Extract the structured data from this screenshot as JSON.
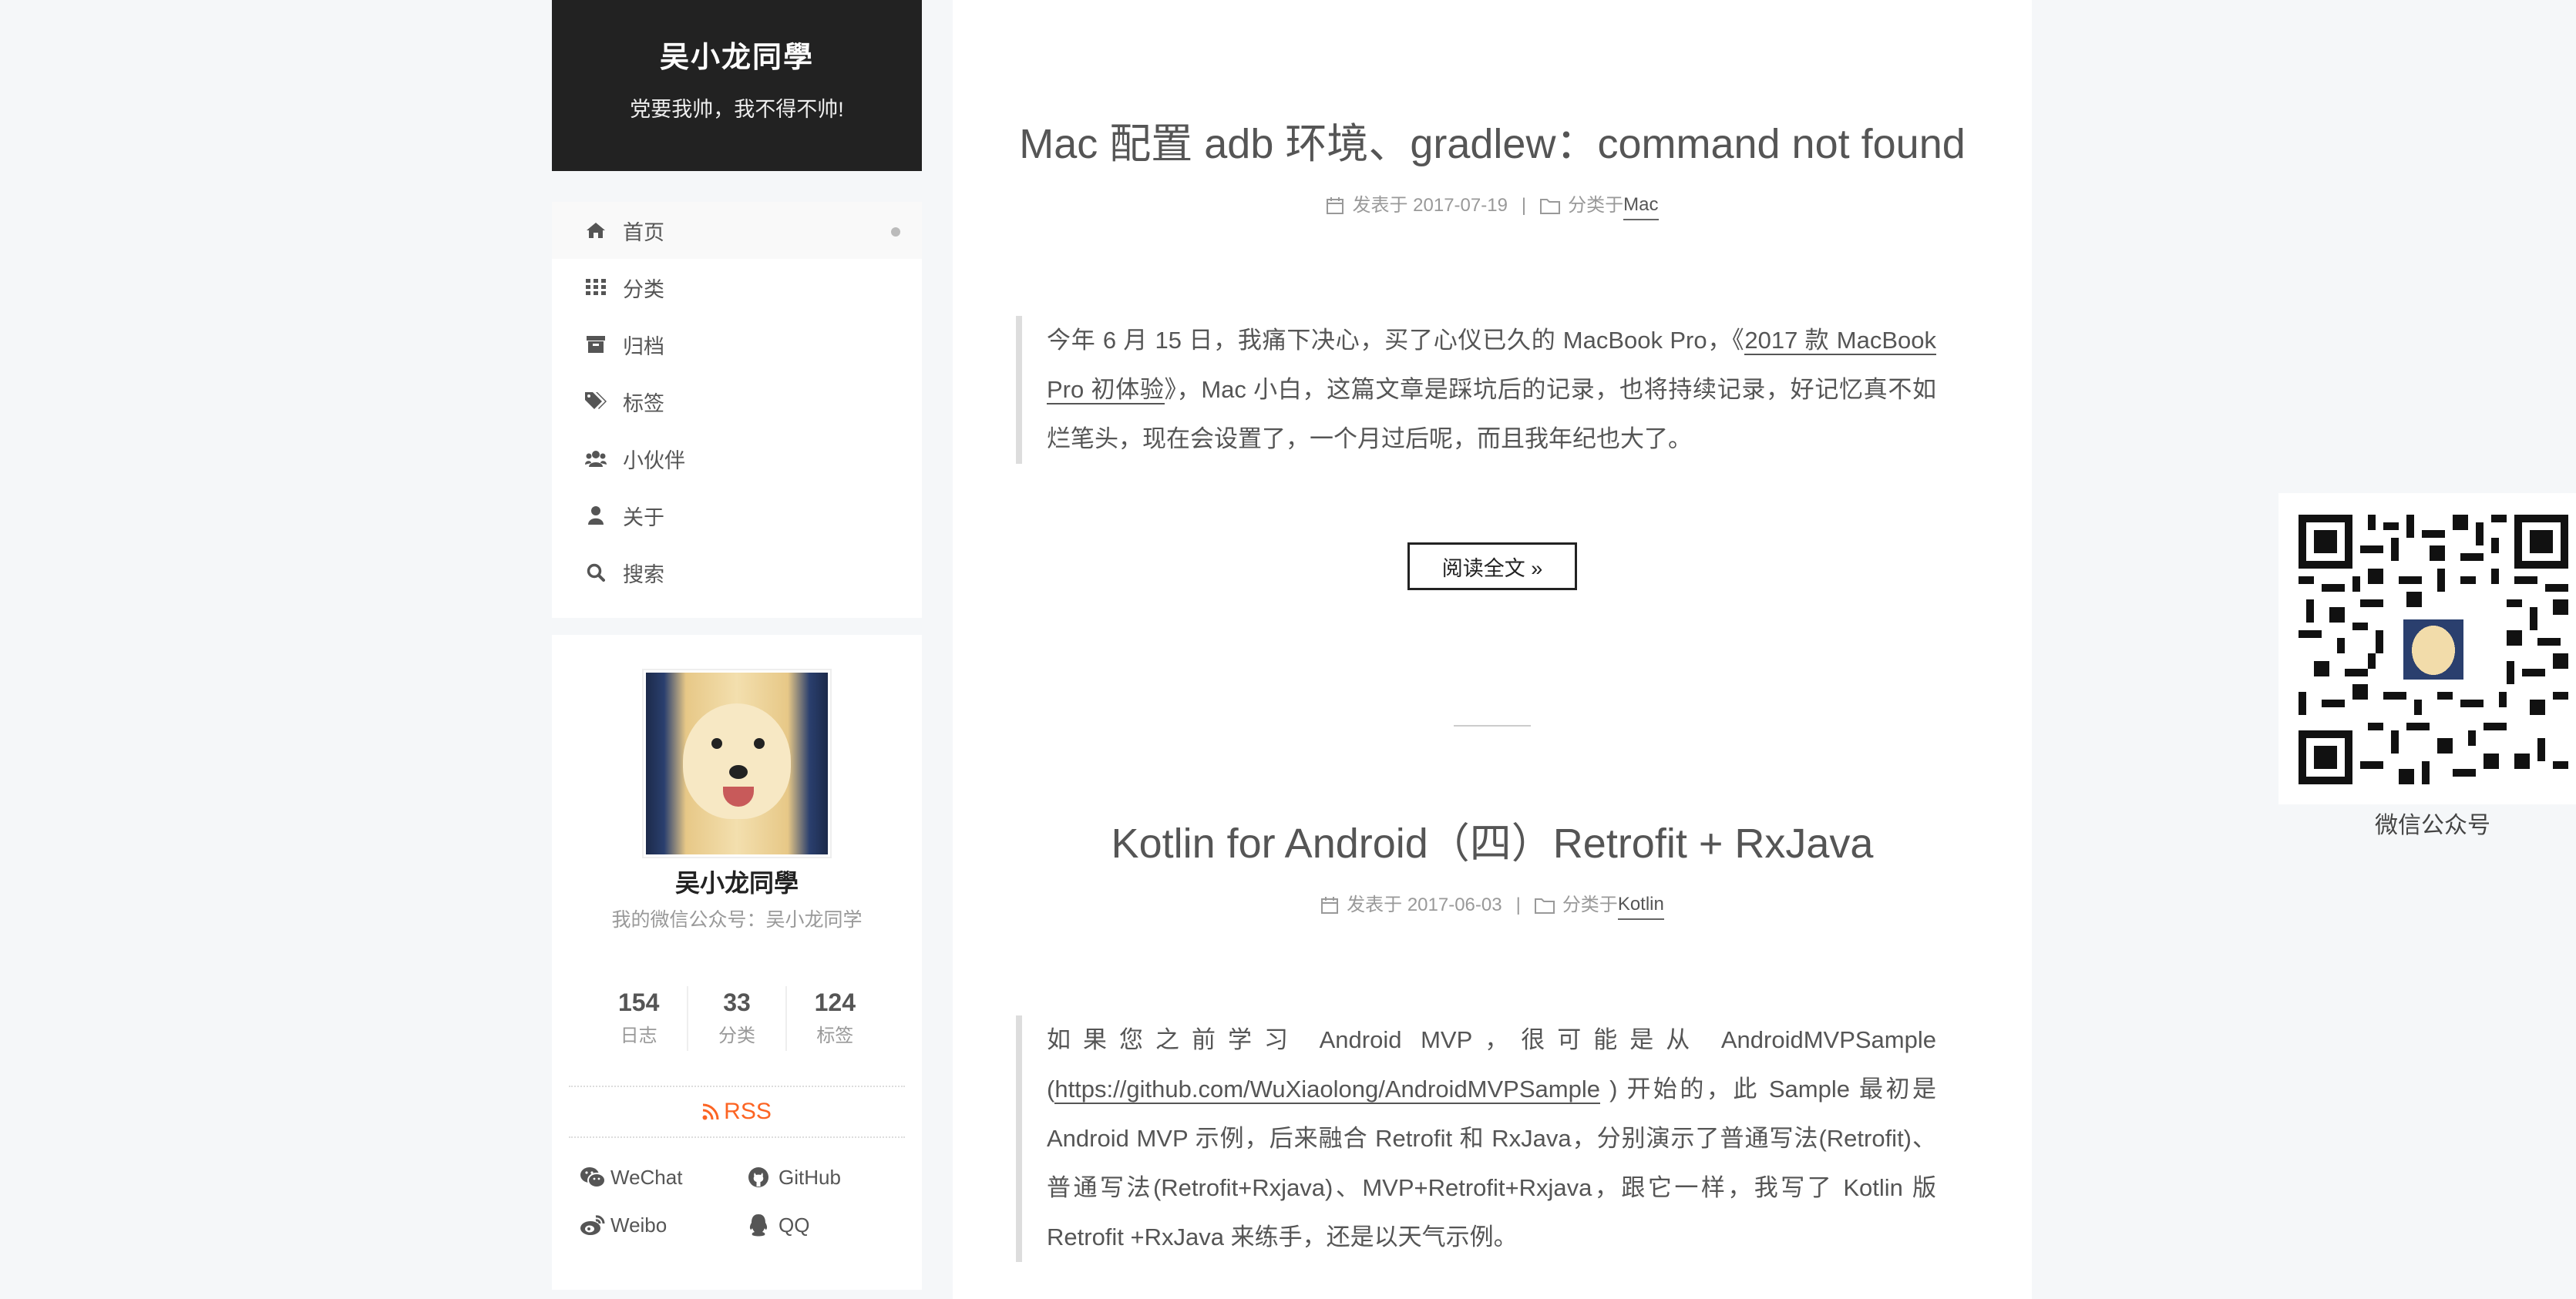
{
  "site": {
    "title": "吴小龙同學",
    "subtitle": "党要我帅，我不得不帅!"
  },
  "menu": {
    "items": [
      {
        "label": "首页",
        "icon": "home-icon",
        "active": true
      },
      {
        "label": "分类",
        "icon": "grid-icon",
        "active": false
      },
      {
        "label": "归档",
        "icon": "archive-icon",
        "active": false
      },
      {
        "label": "标签",
        "icon": "tags-icon",
        "active": false
      },
      {
        "label": "小伙伴",
        "icon": "users-icon",
        "active": false
      },
      {
        "label": "关于",
        "icon": "user-icon",
        "active": false
      },
      {
        "label": "搜索",
        "icon": "search-icon",
        "active": false
      }
    ]
  },
  "author": {
    "name": "吴小龙同學",
    "description": "我的微信公众号：吴小龙同学",
    "stats": [
      {
        "count": "154",
        "label": "日志"
      },
      {
        "count": "33",
        "label": "分类"
      },
      {
        "count": "124",
        "label": "标签"
      }
    ],
    "rss_label": "RSS",
    "links": [
      {
        "label": "WeChat",
        "icon": "wechat-icon"
      },
      {
        "label": "GitHub",
        "icon": "github-icon"
      },
      {
        "label": "Weibo",
        "icon": "weibo-icon"
      },
      {
        "label": "QQ",
        "icon": "qq-icon"
      }
    ]
  },
  "posts": [
    {
      "title": "Mac 配置 adb 环境、gradlew：command not found",
      "posted_prefix": "发表于",
      "date": "2017-07-19",
      "category_prefix": "分类于",
      "category": "Mac",
      "excerpt_before": "今年 6 月 15 日，我痛下决心，买了心仪已久的 MacBook Pro，《",
      "excerpt_link": "2017 款 MacBook Pro 初体验",
      "excerpt_after": "》，Mac 小白，这篇文章是踩坑后的记录，也将持续记录，好记忆真不如烂笔头，现在会设置了，一个月过后呢，而且我年纪也大了。",
      "read_more": "阅读全文 »"
    },
    {
      "title": "Kotlin for Android（四）Retrofit + RxJava",
      "posted_prefix": "发表于",
      "date": "2017-06-03",
      "category_prefix": "分类于",
      "category": "Kotlin",
      "excerpt_before": "如果您之前学习 Android MVP，很可能是从 AndroidMVPSample (",
      "excerpt_link": "https://github.com/WuXiaolong/AndroidMVPSample",
      "excerpt_after": " ) 开始的，此 Sample 最初是 Android MVP 示例，后来融合 Retrofit 和 RxJava，分别演示了普通写法(Retrofit)、普通写法(Retrofit+Rxjava)、MVP+Retrofit+Rxjava，跟它一样，我写了 Kotlin 版 Retrofit +RxJava 来练手，还是以天气示例。"
    }
  ],
  "qr": {
    "caption": "微信公众号"
  },
  "colors": {
    "brand_bg": "#222222",
    "page_bg": "#f5f7f9",
    "rss_orange": "#fc6423",
    "text": "#555555",
    "muted": "#999999"
  }
}
